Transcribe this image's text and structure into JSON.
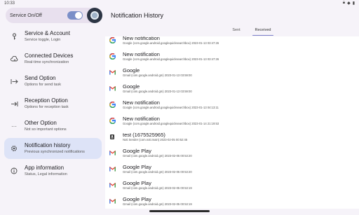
{
  "status_bar": {
    "time": "10:33"
  },
  "service": {
    "label": "Service On/Off"
  },
  "nav": [
    {
      "title": "Service & Account",
      "subtitle": "Service toggle, Login",
      "icon": "key-icon"
    },
    {
      "title": "Connected Devices",
      "subtitle": "Real-time synchronization",
      "icon": "cloud-sync-icon"
    },
    {
      "title": "Send Option",
      "subtitle": "Options for send task",
      "icon": "send-arrow-icon"
    },
    {
      "title": "Reception Option",
      "subtitle": "Options for reception task",
      "icon": "receive-arrow-icon"
    },
    {
      "title": "Other Option",
      "subtitle": "Not so important options",
      "icon": "more-icon"
    },
    {
      "title": "Notification history",
      "subtitle": "Previous synchronized notifications",
      "icon": "settings-icon"
    },
    {
      "title": "App information",
      "subtitle": "Status, Legal information",
      "icon": "info-icon"
    }
  ],
  "main": {
    "title": "Notification History",
    "tabs": [
      "Sent",
      "Received"
    ],
    "active_tab": "Received"
  },
  "notifications": [
    {
      "app": "google",
      "title": "New notification",
      "sub": "Google (com.google.android.googlequicksearchbox) 2023-01-13 03:47:26"
    },
    {
      "app": "google",
      "title": "New notification",
      "sub": "Google (com.google.android.googlequicksearchbox) 2023-01-13 03:47:26"
    },
    {
      "app": "gmail",
      "title": "Google",
      "sub": "Gmail (com.google.android.gm) 2023-01-13 03:59:00"
    },
    {
      "app": "gmail",
      "title": "Google",
      "sub": "Gmail (com.google.android.gm) 2023-01-13 03:59:00"
    },
    {
      "app": "google",
      "title": "New notification",
      "sub": "Google (com.google.android.googlequicksearchbox) 2023-01-13 04:13:11"
    },
    {
      "app": "google",
      "title": "New notification",
      "sub": "Google (com.google.android.googlequicksearchbox) 2023-01-14 21:19:53"
    },
    {
      "app": "noti",
      "title": "test (1675525965)",
      "sub": "Noti Sender (com.noti.main) 2023-02-05 00:52:45"
    },
    {
      "app": "gmail",
      "title": "Google Play",
      "sub": "Gmail (com.google.android.gm) 2023-02-05 00:53:20"
    },
    {
      "app": "gmail",
      "title": "Google Play",
      "sub": "Gmail (com.google.android.gm) 2023-02-05 00:53:20"
    },
    {
      "app": "gmail",
      "title": "Google Play",
      "sub": "Gmail (com.google.android.gm) 2023-02-05 00:53:19"
    },
    {
      "app": "gmail",
      "title": "Google Play",
      "sub": "Gmail (com.google.android.gm) 2023-02-05 00:53:19"
    }
  ]
}
